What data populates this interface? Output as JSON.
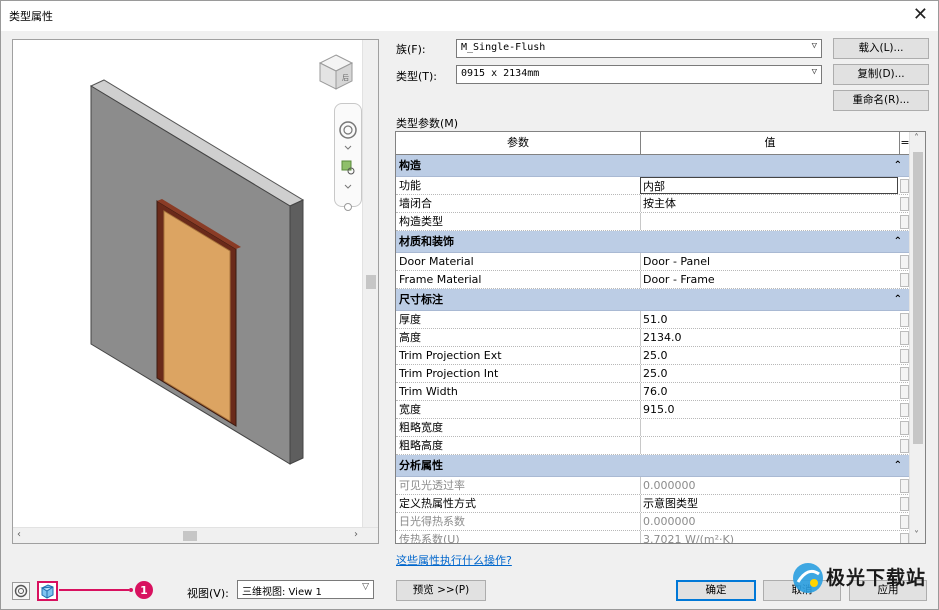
{
  "window": {
    "title": "类型属性",
    "close_glyph": "✕"
  },
  "preview": {
    "scroll_left_glyph": "‹",
    "scroll_right_glyph": "›",
    "cube_label": "后"
  },
  "family": {
    "label": "族(F):",
    "value": "M_Single-Flush",
    "load_button": "载入(L)..."
  },
  "type": {
    "label": "类型(T):",
    "value": "0915 x 2134mm",
    "duplicate_button": "复制(D)...",
    "rename_button": "重命名(R)..."
  },
  "params": {
    "section_label": "类型参数(M)",
    "col_param": "参数",
    "col_value": "值",
    "col_eq": "=",
    "groups": [
      {
        "name": "构造",
        "rows": [
          {
            "p": "功能",
            "v": "内部"
          },
          {
            "p": "墙闭合",
            "v": "按主体"
          },
          {
            "p": "构造类型",
            "v": ""
          }
        ]
      },
      {
        "name": "材质和装饰",
        "rows": [
          {
            "p": "Door Material",
            "v": "Door - Panel"
          },
          {
            "p": "Frame Material",
            "v": "Door - Frame"
          }
        ]
      },
      {
        "name": "尺寸标注",
        "rows": [
          {
            "p": "厚度",
            "v": "51.0"
          },
          {
            "p": "高度",
            "v": "2134.0"
          },
          {
            "p": "Trim Projection Ext",
            "v": "25.0"
          },
          {
            "p": "Trim Projection Int",
            "v": "25.0"
          },
          {
            "p": "Trim Width",
            "v": "76.0"
          },
          {
            "p": "宽度",
            "v": "915.0"
          },
          {
            "p": "粗略宽度",
            "v": ""
          },
          {
            "p": "粗略高度",
            "v": ""
          }
        ]
      },
      {
        "name": "分析属性",
        "rows": [
          {
            "p": "可见光透过率",
            "v": "0.000000"
          },
          {
            "p": "定义热属性方式",
            "v": "示意图类型"
          },
          {
            "p": "日光得热系数",
            "v": "0.000000"
          },
          {
            "p": "传热系数(U)",
            "v": "3.7021 W/(m²·K)"
          }
        ]
      }
    ]
  },
  "help_link": "这些属性执行什么操作?",
  "view": {
    "label": "视图(V):",
    "value": "三维视图: View 1"
  },
  "preview_button": "预览 >>(P)",
  "ok_button": "确定",
  "cancel_button": "取消",
  "apply_button": "应用",
  "callout_number": "1",
  "watermark": "极光下载站",
  "colors": {
    "group_header": "#bccde5",
    "callout": "#d8115f",
    "accent": "#0078d7",
    "link": "#0066cc"
  }
}
